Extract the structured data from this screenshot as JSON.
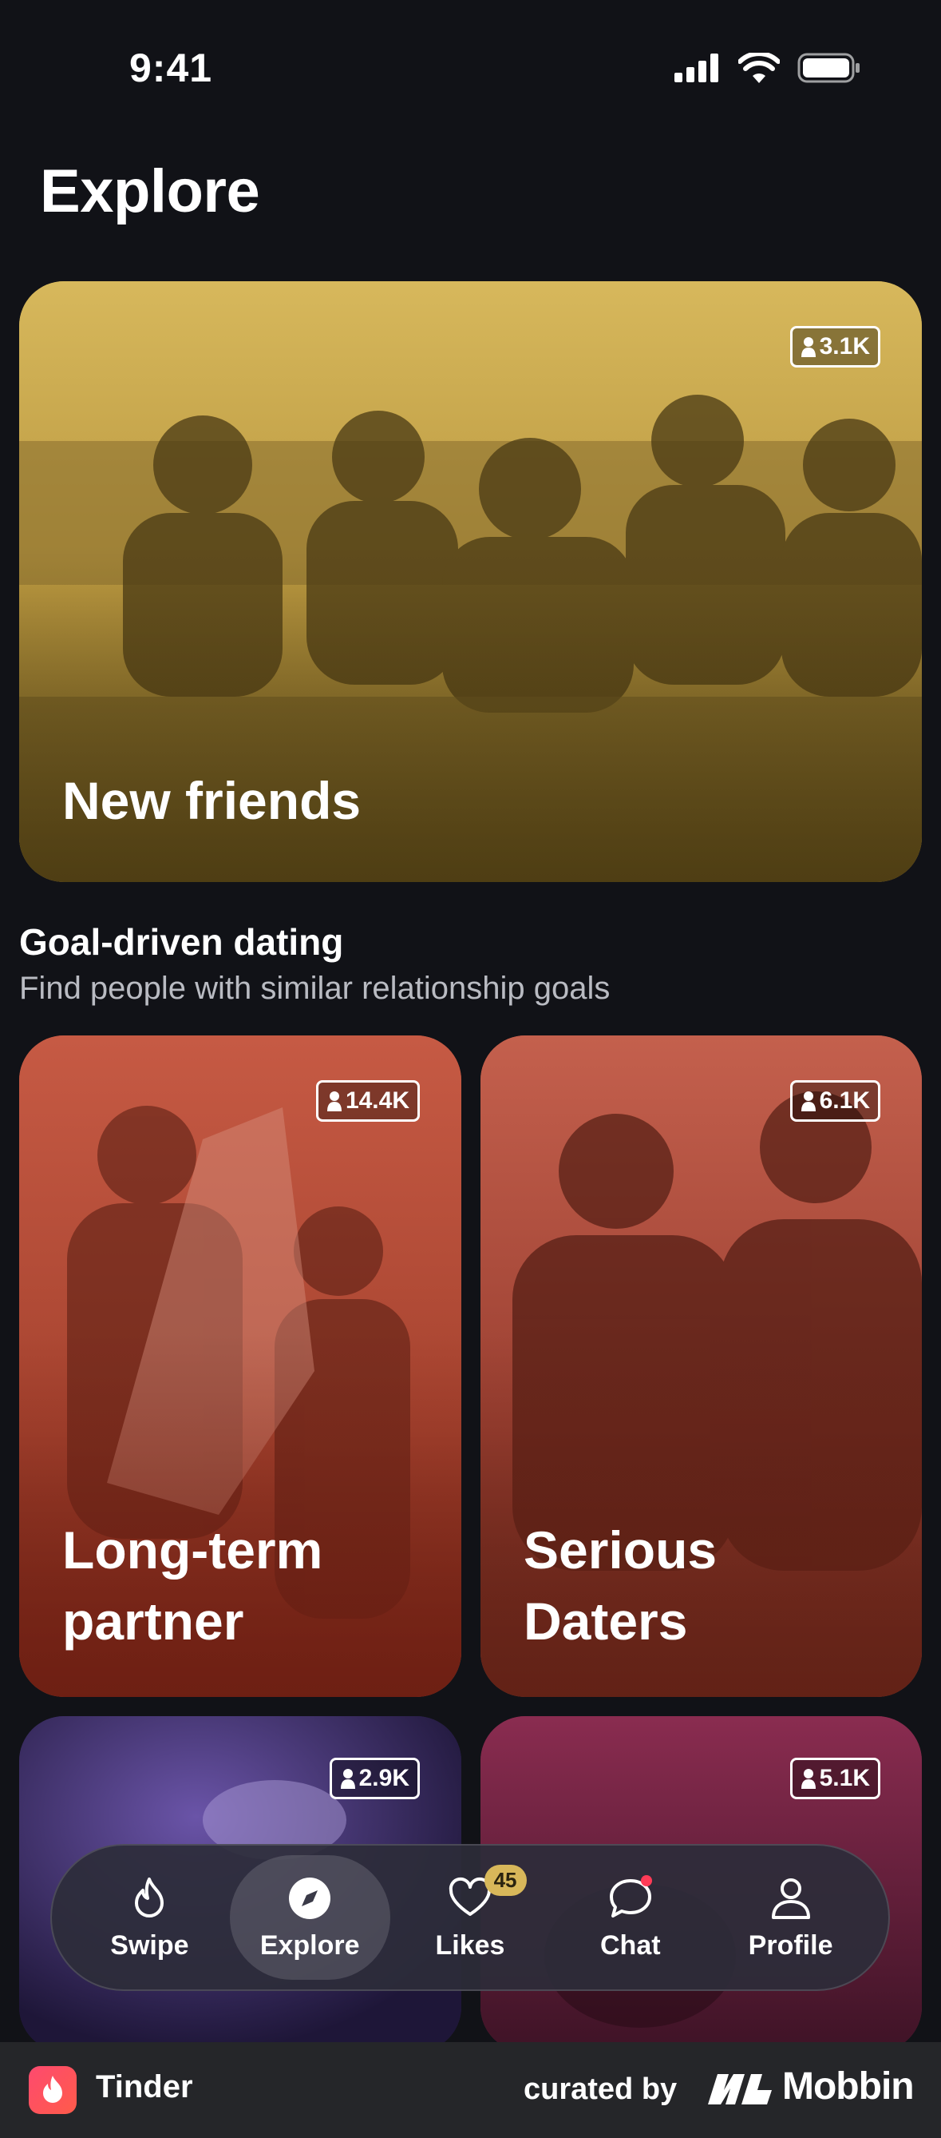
{
  "status_bar": {
    "time": "9:41"
  },
  "page": {
    "title": "Explore"
  },
  "featured": {
    "title": "New friends",
    "count": "3.1K",
    "tint": "#d9b85a"
  },
  "section": {
    "title": "Goal-driven dating",
    "subtitle": "Find people with similar relationship goals"
  },
  "cards": [
    {
      "title_line1": "Long-term",
      "title_line2": "partner",
      "count": "14.4K",
      "tint": "#c8573f"
    },
    {
      "title_line1": "Serious",
      "title_line2": "Daters",
      "count": "6.1K",
      "tint": "#c55a48"
    },
    {
      "count": "2.9K",
      "tint": "#3d2a6b"
    },
    {
      "count": "5.1K",
      "tint": "#7c2848"
    }
  ],
  "nav": {
    "items": [
      {
        "label": "Swipe",
        "icon": "flame-icon"
      },
      {
        "label": "Explore",
        "icon": "compass-icon"
      },
      {
        "label": "Likes",
        "icon": "heart-icon",
        "badge": "45"
      },
      {
        "label": "Chat",
        "icon": "chat-icon"
      },
      {
        "label": "Profile",
        "icon": "profile-icon"
      }
    ],
    "active": "Explore"
  },
  "footer": {
    "app_name": "Tinder",
    "curated_label": "curated by",
    "brand": "Mobbin"
  }
}
